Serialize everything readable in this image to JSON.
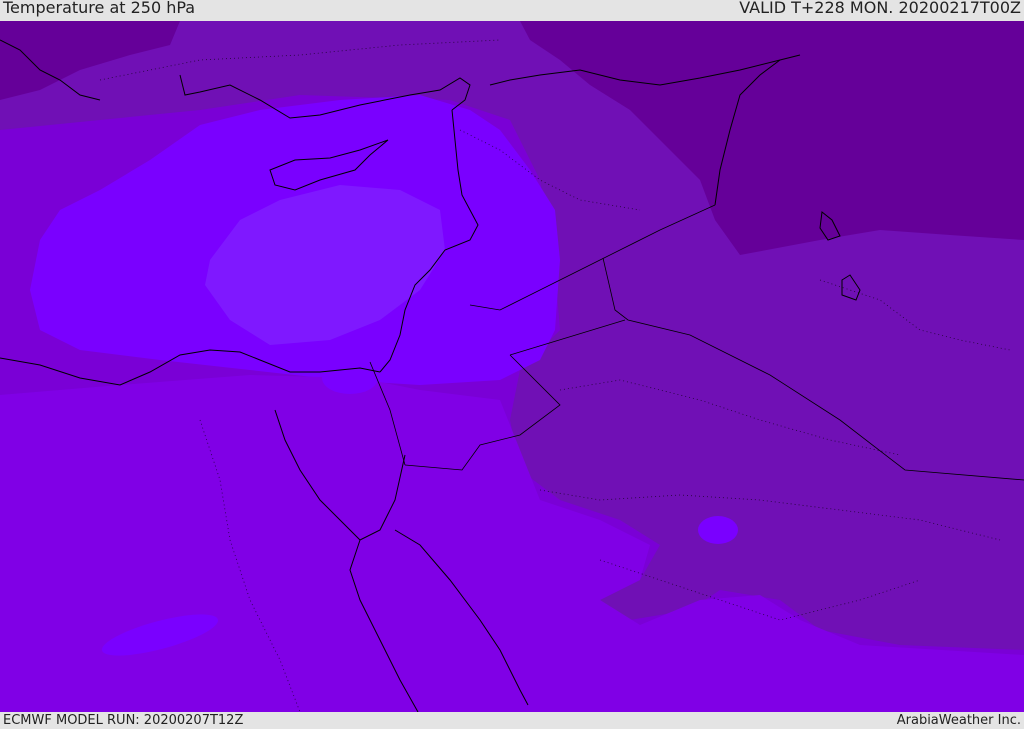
{
  "header": {
    "title": "Temperature at 250 hPa",
    "valid": "VALID T+228 MON. 20200217T00Z"
  },
  "footer": {
    "model_run": "ECMWF MODEL RUN: 20200207T12Z",
    "credit": "ArabiaWeather Inc."
  },
  "colors": {
    "band_coldest": "#650099",
    "band_cold": "#7010b5",
    "band_mid": "#7a00d6",
    "band_warm": "#8000e6",
    "band_warmer": "#7a00ff",
    "band_warmest": "#7f18ff",
    "coastline": "#000000"
  }
}
